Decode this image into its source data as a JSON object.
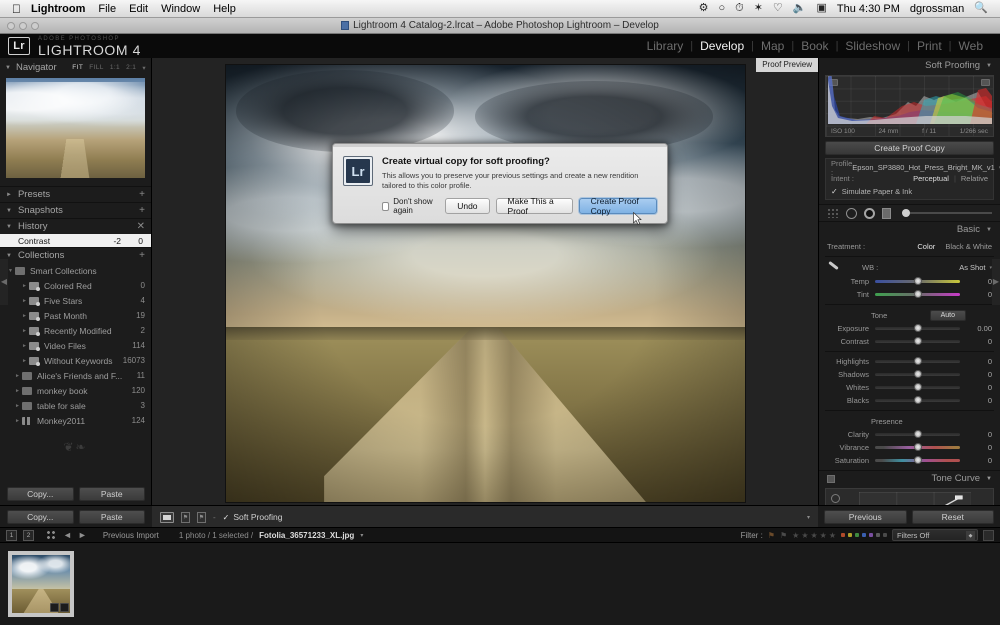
{
  "menubar": {
    "apple_icon": "apple-icon",
    "items": [
      "Lightroom",
      "File",
      "Edit",
      "Window",
      "Help"
    ],
    "status_icons": [
      "dropbox-icon",
      "sync-icon",
      "timemachine-icon",
      "bluetooth-icon",
      "wifi-icon",
      "volume-icon",
      "displays-icon"
    ],
    "clock": "Thu 4:30 PM",
    "user": "dgrossman",
    "search_icon": "spotlight-search-icon"
  },
  "titlebar": {
    "title": "Lightroom 4 Catalog-2.lrcat – Adobe Photoshop Lightroom – Develop",
    "doc_icon": "catalog-file-icon"
  },
  "identity": {
    "badge": "Lr",
    "overline": "ADOBE PHOTOSHOP",
    "name": "LIGHTROOM 4"
  },
  "modules": {
    "items": [
      {
        "label": "Library",
        "active": false
      },
      {
        "label": "Develop",
        "active": true
      },
      {
        "label": "Map",
        "active": false
      },
      {
        "label": "Book",
        "active": false
      },
      {
        "label": "Slideshow",
        "active": false
      },
      {
        "label": "Print",
        "active": false
      },
      {
        "label": "Web",
        "active": false
      }
    ],
    "separator": "|"
  },
  "left_panel": {
    "navigator": {
      "title": "Navigator",
      "triangle": "▼",
      "zoom_levels": [
        "FIT",
        "FILL",
        "1:1",
        "2:1"
      ],
      "active_zoom": "FIT",
      "caret": "▾"
    },
    "presets": {
      "title": "Presets",
      "triangle": "►",
      "plus": "+"
    },
    "snapshots": {
      "title": "Snapshots",
      "triangle": "▼",
      "plus": "+"
    },
    "history": {
      "title": "History",
      "triangle": "▼",
      "clear": "✕",
      "rows": [
        {
          "name": "Contrast",
          "delta": "-2",
          "value": "0"
        }
      ]
    },
    "collections": {
      "title": "Collections",
      "triangle": "▼",
      "plus": "+",
      "items": [
        {
          "label": "Smart Collections",
          "count": "",
          "level": 1,
          "icon": "collection-set-icon",
          "triangle": "▼"
        },
        {
          "label": "Colored Red",
          "count": "0",
          "level": 2,
          "icon": "smart-collection-icon",
          "triangle": "►"
        },
        {
          "label": "Five Stars",
          "count": "4",
          "level": 2,
          "icon": "smart-collection-icon",
          "triangle": "►"
        },
        {
          "label": "Past Month",
          "count": "19",
          "level": 2,
          "icon": "smart-collection-icon",
          "triangle": "►"
        },
        {
          "label": "Recently Modified",
          "count": "2",
          "level": 2,
          "icon": "smart-collection-icon",
          "triangle": "►"
        },
        {
          "label": "Video Files",
          "count": "114",
          "level": 2,
          "icon": "smart-collection-icon",
          "triangle": "►"
        },
        {
          "label": "Without Keywords",
          "count": "16073",
          "level": 2,
          "icon": "smart-collection-icon",
          "triangle": "►"
        },
        {
          "label": "Alice's Friends and F...",
          "count": "11",
          "level": 1,
          "icon": "collection-set-icon",
          "triangle": "►"
        },
        {
          "label": "monkey book",
          "count": "120",
          "level": 1,
          "icon": "collection-set-icon",
          "triangle": "►"
        },
        {
          "label": "table for sale",
          "count": "3",
          "level": 1,
          "icon": "collection-set-icon",
          "triangle": "►"
        },
        {
          "label": "Monkey2011",
          "count": "124",
          "level": 1,
          "icon": "collection-book-icon",
          "triangle": "►"
        }
      ]
    },
    "copy_button": "Copy...",
    "paste_button": "Paste"
  },
  "center": {
    "proof_preview_badge": "Proof Preview"
  },
  "right_panel": {
    "soft_proofing": {
      "title": "Soft Proofing",
      "triangle": "▼"
    },
    "histogram": {
      "iso": "ISO 100",
      "focal": "24 mm",
      "aperture": "f / 11",
      "shutter": "1/266 sec",
      "shadow_clip_icon": "shadow-clipping-icon",
      "highlight_clip_icon": "highlight-clipping-icon"
    },
    "create_proof_copy_button": "Create Proof Copy",
    "proof_settings": {
      "profile_label": "Profile :",
      "profile_value": "Epson_SP3880_Hot_Press_Bright_MK_v1",
      "intent_label": "Intent :",
      "intent_options": [
        {
          "label": "Perceptual",
          "active": true
        },
        {
          "label": "Relative",
          "active": false
        }
      ],
      "simulate_label": "Simulate Paper & Ink",
      "simulate_checked": "✓"
    },
    "tools": [
      "spot-removal-icon",
      "red-eye-icon",
      "graduated-filter-icon",
      "adjustment-brush-icon"
    ],
    "basic": {
      "title": "Basic",
      "triangle": "▼",
      "treatment_label": "Treatment :",
      "treatment_options": [
        {
          "label": "Color",
          "active": true
        },
        {
          "label": "Black & White",
          "active": false
        }
      ],
      "wb_label": "WB :",
      "wb_value": "As Shot",
      "eyedropper_icon": "white-balance-eyedropper-icon",
      "wb_sliders": [
        {
          "label": "Temp",
          "value": "0",
          "track": "temp"
        },
        {
          "label": "Tint",
          "value": "0",
          "track": "tint"
        }
      ],
      "tone_label": "Tone",
      "auto_button": "Auto",
      "tone_sliders": [
        {
          "label": "Exposure",
          "value": "0.00",
          "track": ""
        },
        {
          "label": "Contrast",
          "value": "0",
          "track": ""
        },
        {
          "label": "Highlights",
          "value": "0",
          "track": ""
        },
        {
          "label": "Shadows",
          "value": "0",
          "track": ""
        },
        {
          "label": "Whites",
          "value": "0",
          "track": ""
        },
        {
          "label": "Blacks",
          "value": "0",
          "track": ""
        }
      ],
      "presence_label": "Presence",
      "presence_sliders": [
        {
          "label": "Clarity",
          "value": "0",
          "track": ""
        },
        {
          "label": "Vibrance",
          "value": "0",
          "track": "vib"
        },
        {
          "label": "Saturation",
          "value": "0",
          "track": "sat"
        }
      ]
    },
    "tone_curve": {
      "title": "Tone Curve",
      "triangle": "▼",
      "target_icon": "target-adjustment-icon",
      "switch_icon": "panel-switch-icon"
    },
    "previous_button": "Previous",
    "reset_button": "Reset"
  },
  "toolbar": {
    "view_icon": "loupe-view-icon",
    "flag_icons": [
      "flag-pick-icon",
      "flag-reject-icon"
    ],
    "dash": "-",
    "soft_proofing_label": "Soft Proofing",
    "soft_proofing_check": "✓",
    "caret": "▾"
  },
  "filmstrip_bar": {
    "nav_back": "1",
    "nav_forward": "2",
    "grid_icon": "grid-view-icon",
    "arrow_left": "◄",
    "arrow_right": "►",
    "source": "Previous Import",
    "count": "1 photo / 1 selected /",
    "filename": "Fotolia_36571233_XL.jpg",
    "filename_caret": "▾",
    "filter_label": "Filter :",
    "flag_icons": [
      "filter-flag-pick-icon",
      "filter-flag-reject-icon"
    ],
    "stars": [
      "★",
      "★",
      "★",
      "★",
      "★"
    ],
    "color_labels": [
      "#b04a2a",
      "#b0a02a",
      "#3f8a3f",
      "#3a5fb0",
      "#7a4fa0",
      "#5a5a5a",
      "#4a4a4a"
    ],
    "filters_select": "Filters Off",
    "filters_caret": "▴▾",
    "lock_icon": "filter-lock-icon"
  },
  "filmstrip": {
    "thumbnail_badges": [
      "photo-badge-crop-icon",
      "photo-badge-develop-icon"
    ]
  },
  "dialog": {
    "icon": "lightroom-app-icon",
    "icon_label": "Lr",
    "title": "Create virtual copy for soft proofing?",
    "body": "This allows you to preserve your previous settings and create a new rendition tailored to this color profile.",
    "checkbox_label": "Don't show again",
    "buttons": [
      {
        "label": "Undo",
        "primary": false
      },
      {
        "label": "Make This a Proof",
        "primary": false
      },
      {
        "label": "Create Proof Copy",
        "primary": true
      }
    ]
  },
  "colors": {
    "accent": "#7fb2e4",
    "panel_bg": "#1c1c1c",
    "canvas_bg": "#232323",
    "text_dim": "#9a9a9a"
  }
}
